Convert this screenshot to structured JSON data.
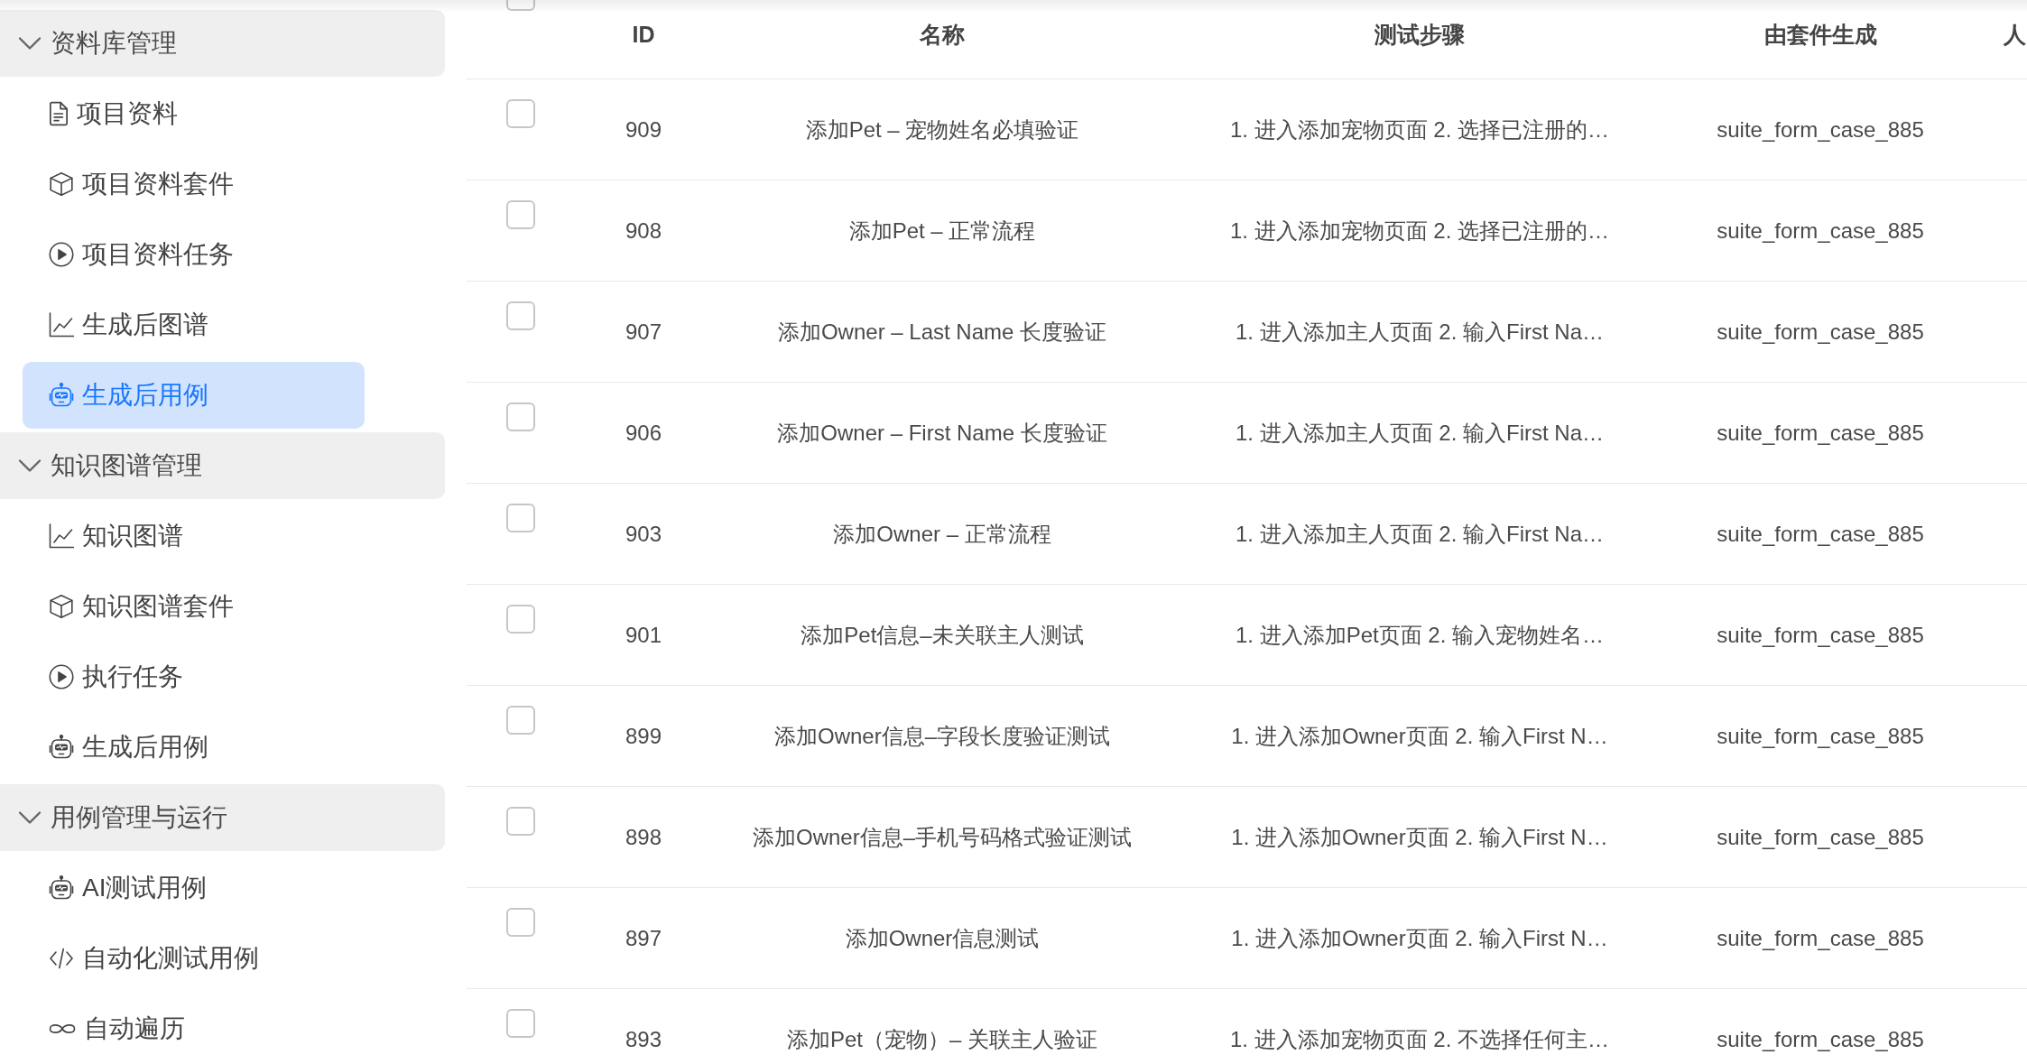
{
  "sidebar": {
    "groups": [
      {
        "label": "资料库管理",
        "expanded": true,
        "items": [
          {
            "label": "项目资料",
            "kind": "file",
            "selected": false
          },
          {
            "label": "项目资料套件",
            "kind": "cube",
            "selected": false
          },
          {
            "label": "项目资料任务",
            "kind": "play",
            "selected": false
          },
          {
            "label": "生成后图谱",
            "kind": "chart",
            "selected": false
          },
          {
            "label": "生成后用例",
            "kind": "robot",
            "selected": true
          }
        ]
      },
      {
        "label": "知识图谱管理",
        "expanded": true,
        "items": [
          {
            "label": "知识图谱",
            "kind": "chart",
            "selected": false
          },
          {
            "label": "知识图谱套件",
            "kind": "cube",
            "selected": false
          },
          {
            "label": "执行任务",
            "kind": "play",
            "selected": false
          },
          {
            "label": "生成后用例",
            "kind": "robot",
            "selected": false
          }
        ]
      },
      {
        "label": "用例管理与运行",
        "expanded": true,
        "items": [
          {
            "label": "AI测试用例",
            "kind": "robot",
            "selected": false
          },
          {
            "label": "自动化测试用例",
            "kind": "code",
            "selected": false
          },
          {
            "label": "自动遍历",
            "kind": "infinity",
            "selected": false
          }
        ]
      }
    ]
  },
  "table": {
    "select_all": {
      "checked": false
    },
    "columns": [
      "ID",
      "名称",
      "测试步骤",
      "由套件生成",
      "人"
    ],
    "rows": [
      {
        "checked": false,
        "cells": [
          "909",
          "添加Pet – 宠物姓名必填验证",
          "1. 进入添加宠物页面 2. 选择已注册的…",
          "suite_form_case_885"
        ]
      },
      {
        "checked": false,
        "cells": [
          "908",
          "添加Pet – 正常流程",
          "1. 进入添加宠物页面 2. 选择已注册的…",
          "suite_form_case_885"
        ]
      },
      {
        "checked": false,
        "cells": [
          "907",
          "添加Owner – Last Name 长度验证",
          "1. 进入添加主人页面 2. 输入First Na…",
          "suite_form_case_885"
        ]
      },
      {
        "checked": false,
        "cells": [
          "906",
          "添加Owner – First Name 长度验证",
          "1. 进入添加主人页面 2. 输入First Na…",
          "suite_form_case_885"
        ]
      },
      {
        "checked": false,
        "cells": [
          "903",
          "添加Owner – 正常流程",
          "1. 进入添加主人页面 2. 输入First Na…",
          "suite_form_case_885"
        ]
      },
      {
        "checked": false,
        "cells": [
          "901",
          "添加Pet信息–未关联主人测试",
          "1. 进入添加Pet页面 2. 输入宠物姓名…",
          "suite_form_case_885"
        ]
      },
      {
        "checked": false,
        "cells": [
          "899",
          "添加Owner信息–字段长度验证测试",
          "1. 进入添加Owner页面 2. 输入First N…",
          "suite_form_case_885"
        ]
      },
      {
        "checked": false,
        "cells": [
          "898",
          "添加Owner信息–手机号码格式验证测试",
          "1. 进入添加Owner页面 2. 输入First N…",
          "suite_form_case_885"
        ]
      },
      {
        "checked": false,
        "cells": [
          "897",
          "添加Owner信息测试",
          "1. 进入添加Owner页面 2. 输入First N…",
          "suite_form_case_885"
        ]
      },
      {
        "checked": false,
        "cells": [
          "893",
          "添加Pet（宠物）– 关联主人验证",
          "1. 进入添加宠物页面 2. 不选择任何主…",
          "suite_form_case_885"
        ]
      }
    ]
  }
}
